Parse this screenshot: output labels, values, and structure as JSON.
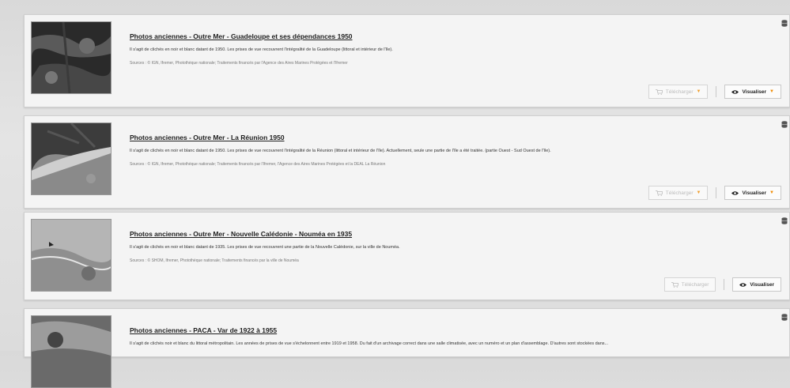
{
  "buttons": {
    "download_label": "Télécharger",
    "view_label": "Visualiser",
    "caret": "▼"
  },
  "items": [
    {
      "title": "Photos anciennes - Outre Mer - Guadeloupe et ses dépendances 1950",
      "description": "Il s'agit de clichés en noir et blanc datant de 1950. Les prises de vue recouvrent l'intégralité de la Guadeloupe (littoral et intérieur de l'île).",
      "sources": "Sources : © IGN, Ifremer, Photothèque nationale; Traitements financés par l'Agence des Aires Marines Protégées et l'Ifremer"
    },
    {
      "title": "Photos anciennes - Outre Mer - La Réunion 1950",
      "description": "Il s'agit de clichés en noir et blanc datant de 1950. Les prises de vue recouvrent l'intégralité de la Réunion (littoral et intérieur de l'île). Actuellement, seule une partie de l'île a été traitée. (partie Ouest - Sud Ouest de l'île).",
      "sources": "Sources : © IGN, Ifremer, Photothèque nationale; Traitements financés par l'Ifremer, l'Agence des Aires Marines Protégées et la DEAL La Réunion"
    },
    {
      "title": "Photos anciennes - Outre Mer - Nouvelle Calédonie - Nouméa en 1935",
      "description": "Il s'agit de clichés en noir et blanc datant de 1935. Les prises de vue recouvrent une partie de la Nouvelle Calédonie, sur la ville de Nouméa.",
      "sources": "Sources : © SHOM, Ifremer, Photothèque nationale; Traitements financés par la ville de Nouméa"
    },
    {
      "title": "Photos anciennes - PACA - Var de 1922 à 1955",
      "description": "Il s'agit de clichés noir et blanc du littoral métropolitain. Les années de prises de vue s'échelonnent entre 1919 et 1958. Du fait d'un archivage correct dans une salle climatisée, avec un numéro et un plan d'assemblage. D'autres sont stockées dans...",
      "sources": ""
    }
  ]
}
